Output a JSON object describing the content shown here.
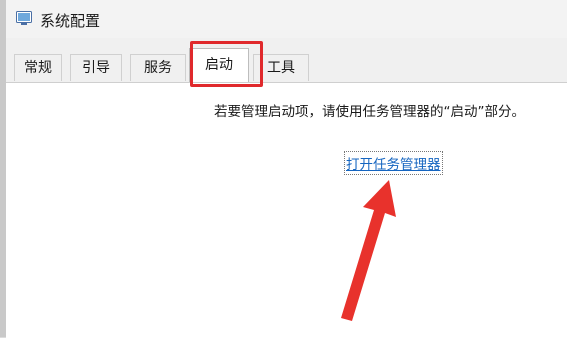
{
  "window": {
    "title": "系统配置",
    "icon": "system-config-icon"
  },
  "tabs": [
    {
      "label": "常规",
      "active": false
    },
    {
      "label": "引导",
      "active": false
    },
    {
      "label": "服务",
      "active": false
    },
    {
      "label": "启动",
      "active": true
    },
    {
      "label": "工具",
      "active": false
    }
  ],
  "startup_panel": {
    "instruction": "若要管理启动项，请使用任务管理器的“启动”部分。",
    "link_label": "打开任务管理器"
  },
  "annotation": {
    "highlight_color": "#e0292c",
    "arrow_color": "#e8322c",
    "arrow_target": "打开任务管理器"
  }
}
